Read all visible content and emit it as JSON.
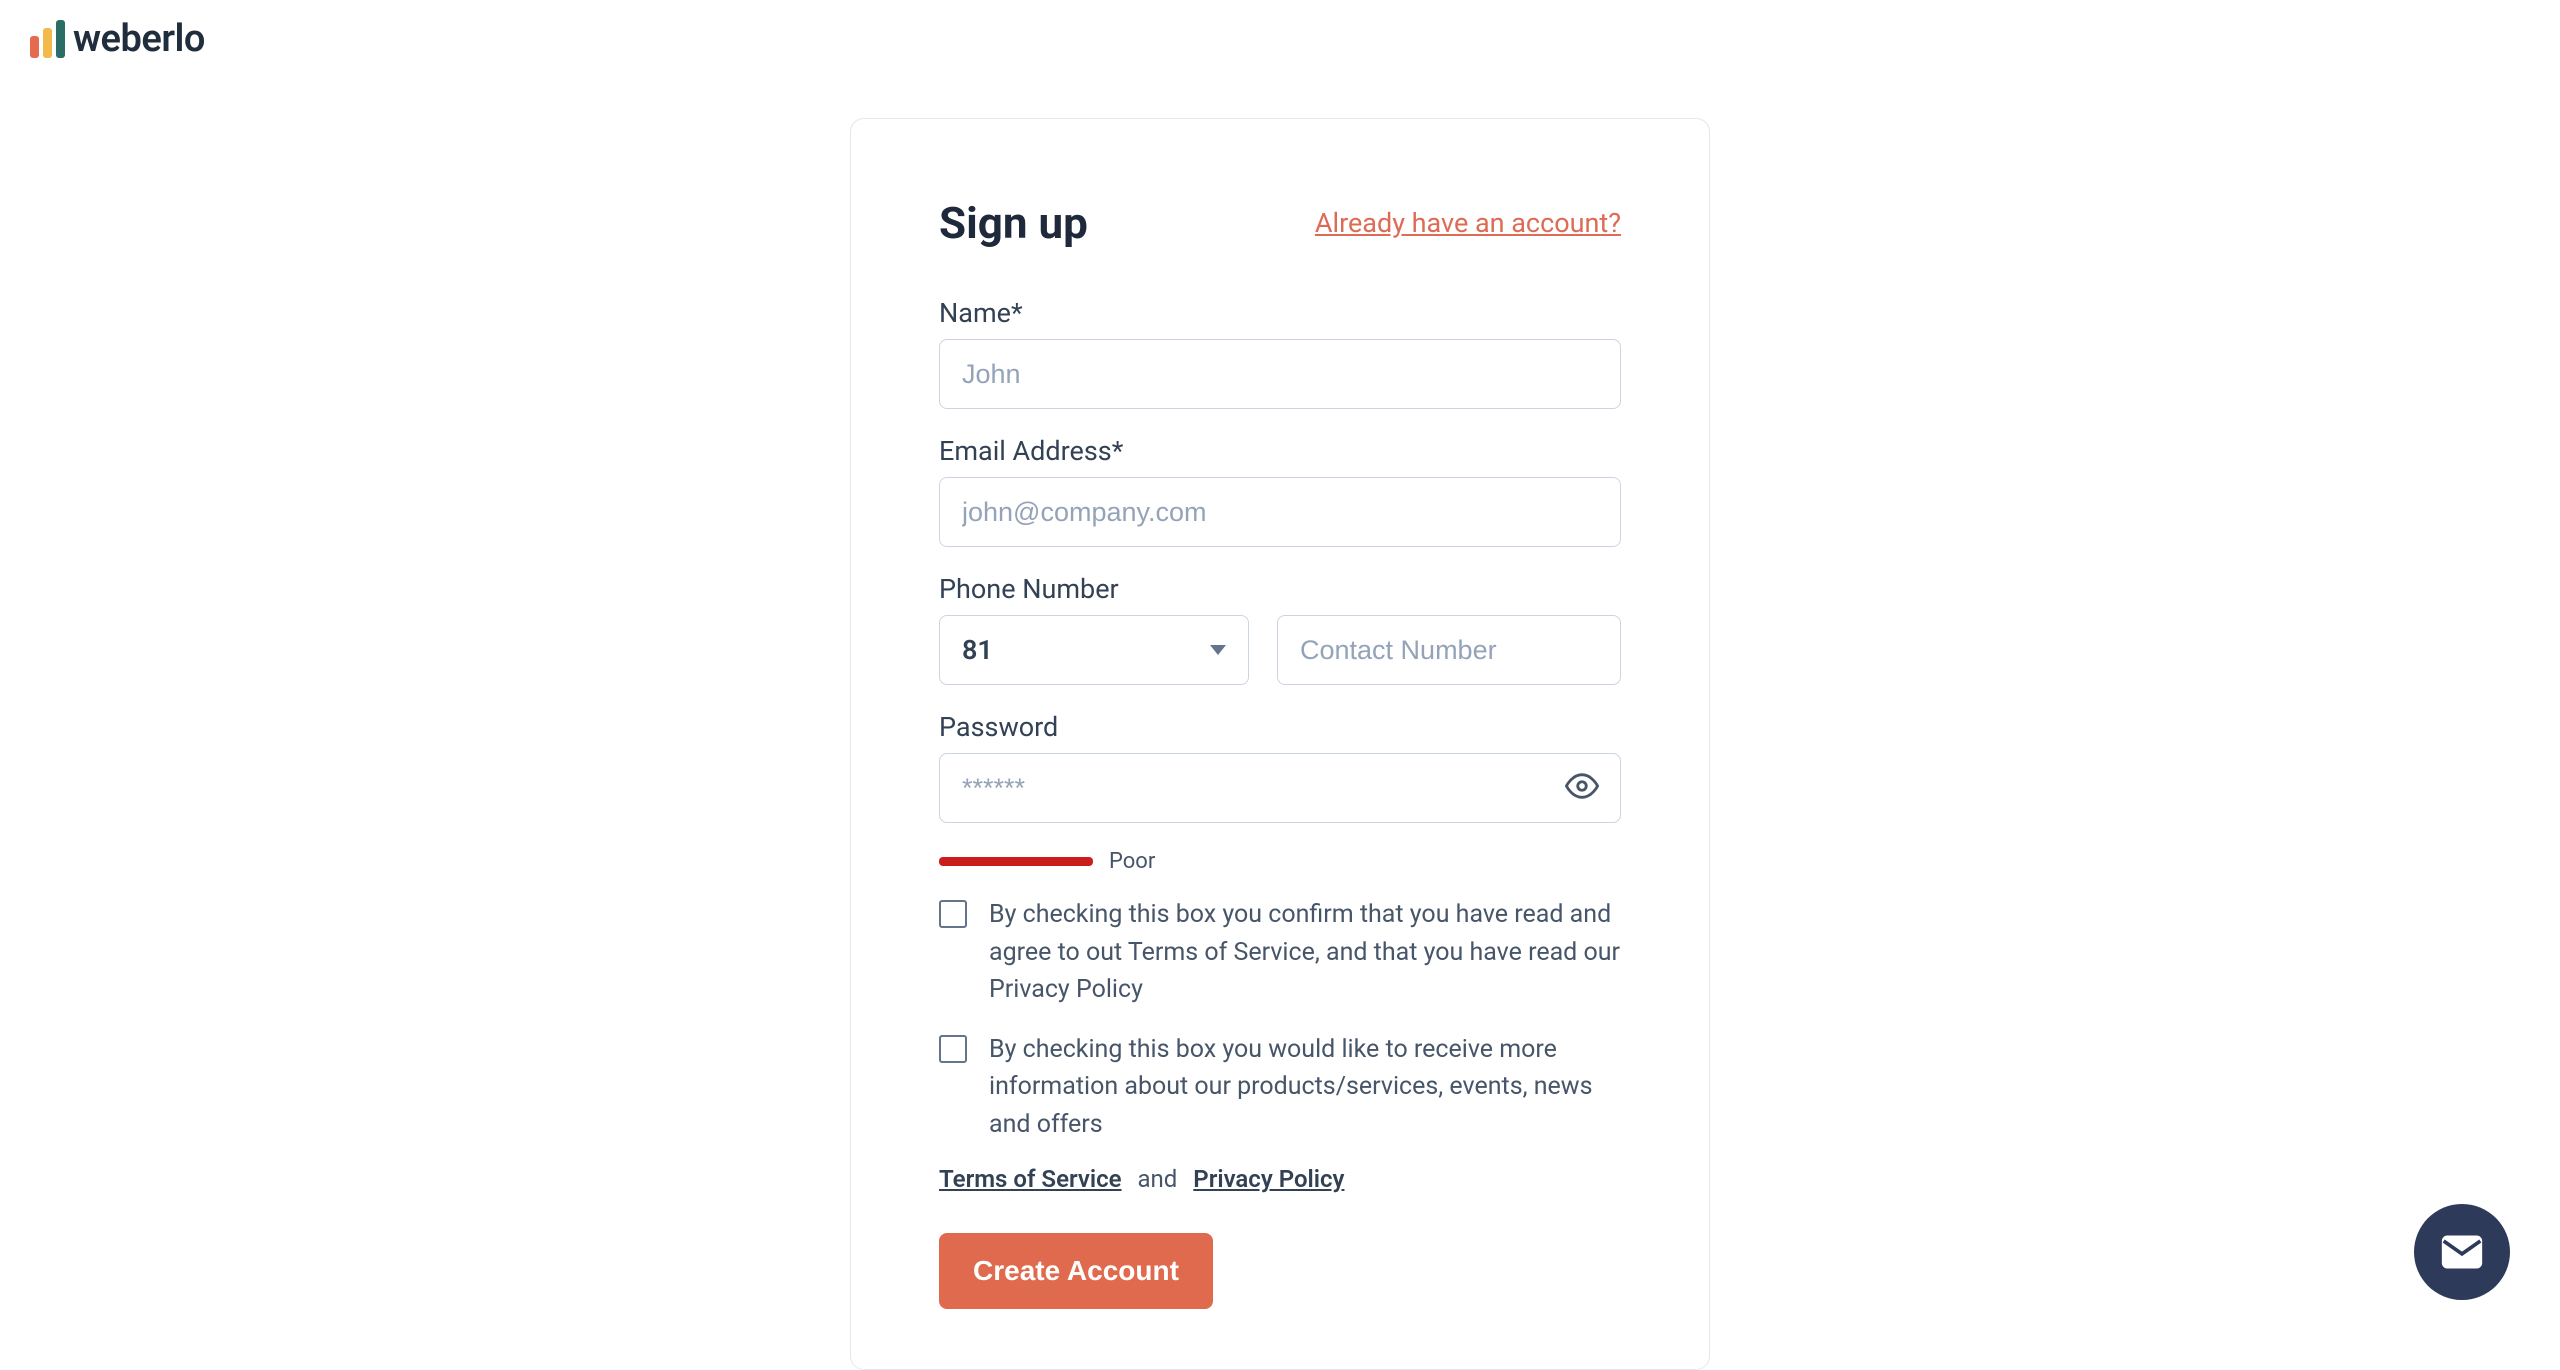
{
  "brand": {
    "name": "weberlo"
  },
  "page": {
    "title": "Sign up",
    "signin_link": "Already have an account?"
  },
  "form": {
    "name": {
      "label": "Name*",
      "placeholder": "John",
      "value": ""
    },
    "email": {
      "label": "Email Address*",
      "placeholder": "john@company.com",
      "value": ""
    },
    "phone": {
      "label": "Phone Number",
      "country_code": "81",
      "placeholder": "Contact Number",
      "value": ""
    },
    "password": {
      "label": "Password",
      "placeholder": "******",
      "value": ""
    },
    "strength": {
      "label": "Poor"
    }
  },
  "checks": {
    "terms": "By checking this box you confirm that you have read and agree to out Terms of Service, and that you have read our Privacy Policy",
    "marketing": "By checking this box you would like to receive more information about our products/services, events, news and offers"
  },
  "legal": {
    "tos": "Terms of Service",
    "sep": "and",
    "privacy": "Privacy Policy"
  },
  "buttons": {
    "submit": "Create Account"
  }
}
